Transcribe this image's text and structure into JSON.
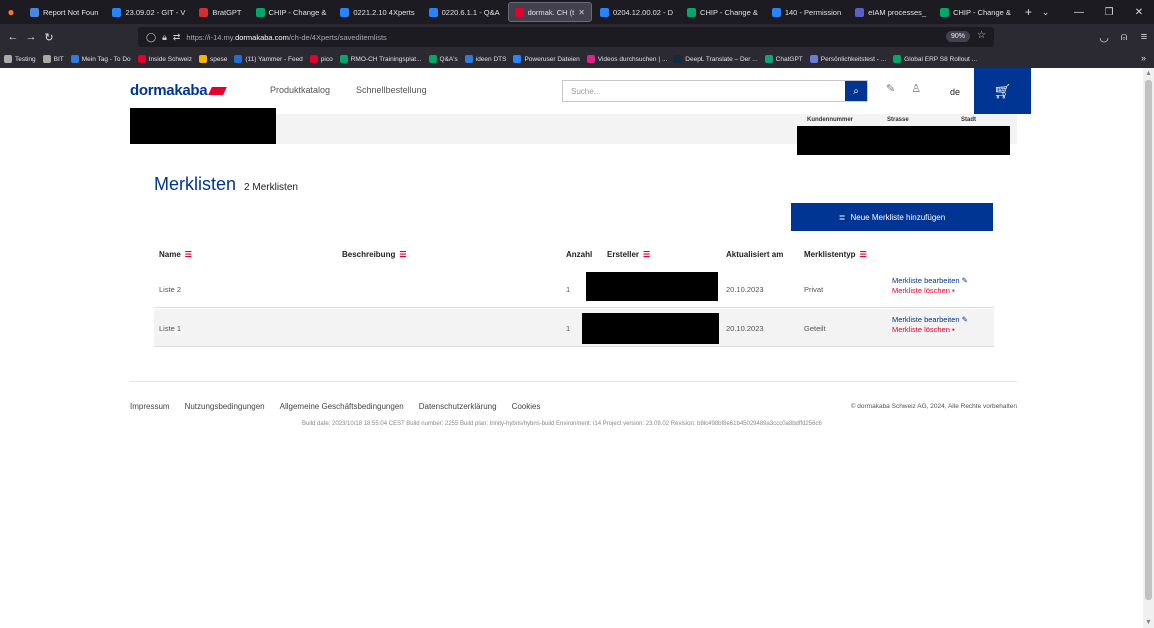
{
  "browser": {
    "tabs": [
      {
        "label": "Report Not Foun",
        "color": "#4a86e8"
      },
      {
        "label": "23.09.02 - GIT - V",
        "color": "#2684ff"
      },
      {
        "label": "BratGPT",
        "color": "#d32f2f"
      },
      {
        "label": "CHIP - Change &",
        "color": "#00a86b"
      },
      {
        "label": "0221.2.10 4Xperts",
        "color": "#2684ff"
      },
      {
        "label": "0220.6.1.1 - Q&A",
        "color": "#2684ff"
      },
      {
        "label": "dormak. CH (t",
        "color": "#e4002b",
        "active": true
      },
      {
        "label": "0204.12.00.02 - D",
        "color": "#2684ff"
      },
      {
        "label": "CHIP - Change &",
        "color": "#00a86b"
      },
      {
        "label": "140 - Permission",
        "color": "#2684ff"
      },
      {
        "label": "eIAM processes_",
        "color": "#5b5fc7"
      },
      {
        "label": "CHIP - Change &",
        "color": "#00a86b"
      }
    ],
    "url_prefix": "https://i-14.my.",
    "url_domain": "dormakaba.com",
    "url_path": "/ch-de/4Xperts/saveditemlists",
    "zoom": "90%",
    "bookmarks": [
      {
        "label": "Testing",
        "color": "#aaaaaa"
      },
      {
        "label": "BIT",
        "color": "#aaaaaa"
      },
      {
        "label": "Mein Tag - To Do",
        "color": "#2f7bdc"
      },
      {
        "label": "Inside Schweiz",
        "color": "#e4002b"
      },
      {
        "label": "spese",
        "color": "#f5b400"
      },
      {
        "label": "(11) Yammer - Feed",
        "color": "#1f6fd1"
      },
      {
        "label": "pico",
        "color": "#e4002b"
      },
      {
        "label": "RMO-CH Trainingsplat...",
        "color": "#00a86b"
      },
      {
        "label": "Q&A's",
        "color": "#00a86b"
      },
      {
        "label": "ideen DTS",
        "color": "#2f7bdc"
      },
      {
        "label": "Poweruser Dateien",
        "color": "#2684ff"
      },
      {
        "label": "Videos durchsuchen | ...",
        "color": "#e0218a"
      },
      {
        "label": "DeepL Translate – Der ...",
        "color": "#0f2b46"
      },
      {
        "label": "ChatGPT",
        "color": "#10a37f"
      },
      {
        "label": "Persönlichkeitstest - ...",
        "color": "#6a7bd8"
      },
      {
        "label": "Global ERP S8 Rollout ...",
        "color": "#00a86b"
      }
    ]
  },
  "header": {
    "logo": "dormakaba",
    "nav": [
      "Produktkatalog",
      "Schnellbestellung"
    ],
    "search_placeholder": "Suche...",
    "lang": "de"
  },
  "customer": {
    "labels": [
      "Kundennummer",
      "Strasse",
      "Stadt"
    ]
  },
  "lists": {
    "title": "Merklisten",
    "count": "2 Merklisten",
    "new_button": "Neue Merkliste hinzufügen",
    "columns": [
      "Name",
      "Beschreibung",
      "Anzahl",
      "Ersteller",
      "Aktualisiert am",
      "Merklistentyp"
    ],
    "rows": [
      {
        "name": "Liste 2",
        "count": "1",
        "updated": "20.10.2023",
        "type": "Privat",
        "edit": "Merkliste bearbeiten",
        "delete": "Merkliste löschen"
      },
      {
        "name": "Liste 1",
        "count": "1",
        "updated": "20.10.2023",
        "type": "Geteilt",
        "edit": "Merkliste bearbeiten",
        "delete": "Merkliste löschen"
      }
    ]
  },
  "footer": {
    "links": [
      "Impressum",
      "Nutzungsbedingungen",
      "Allgemeine Geschäftsbedingungen",
      "Datenschutzerklärung",
      "Cookies"
    ],
    "copyright": "© dormakaba Schweiz AG, 2024, Alle Rechte vorbehalten",
    "build": "Build date: 2023/10/18 18:55:04 CEST Build number: 2255 Build plan: trinity-hybris/hybris-build Environment: i14 Project version: 23.09.02 Revision: b8lc498bf8e61b45029489a3ccc0a8bdffd256c6"
  }
}
